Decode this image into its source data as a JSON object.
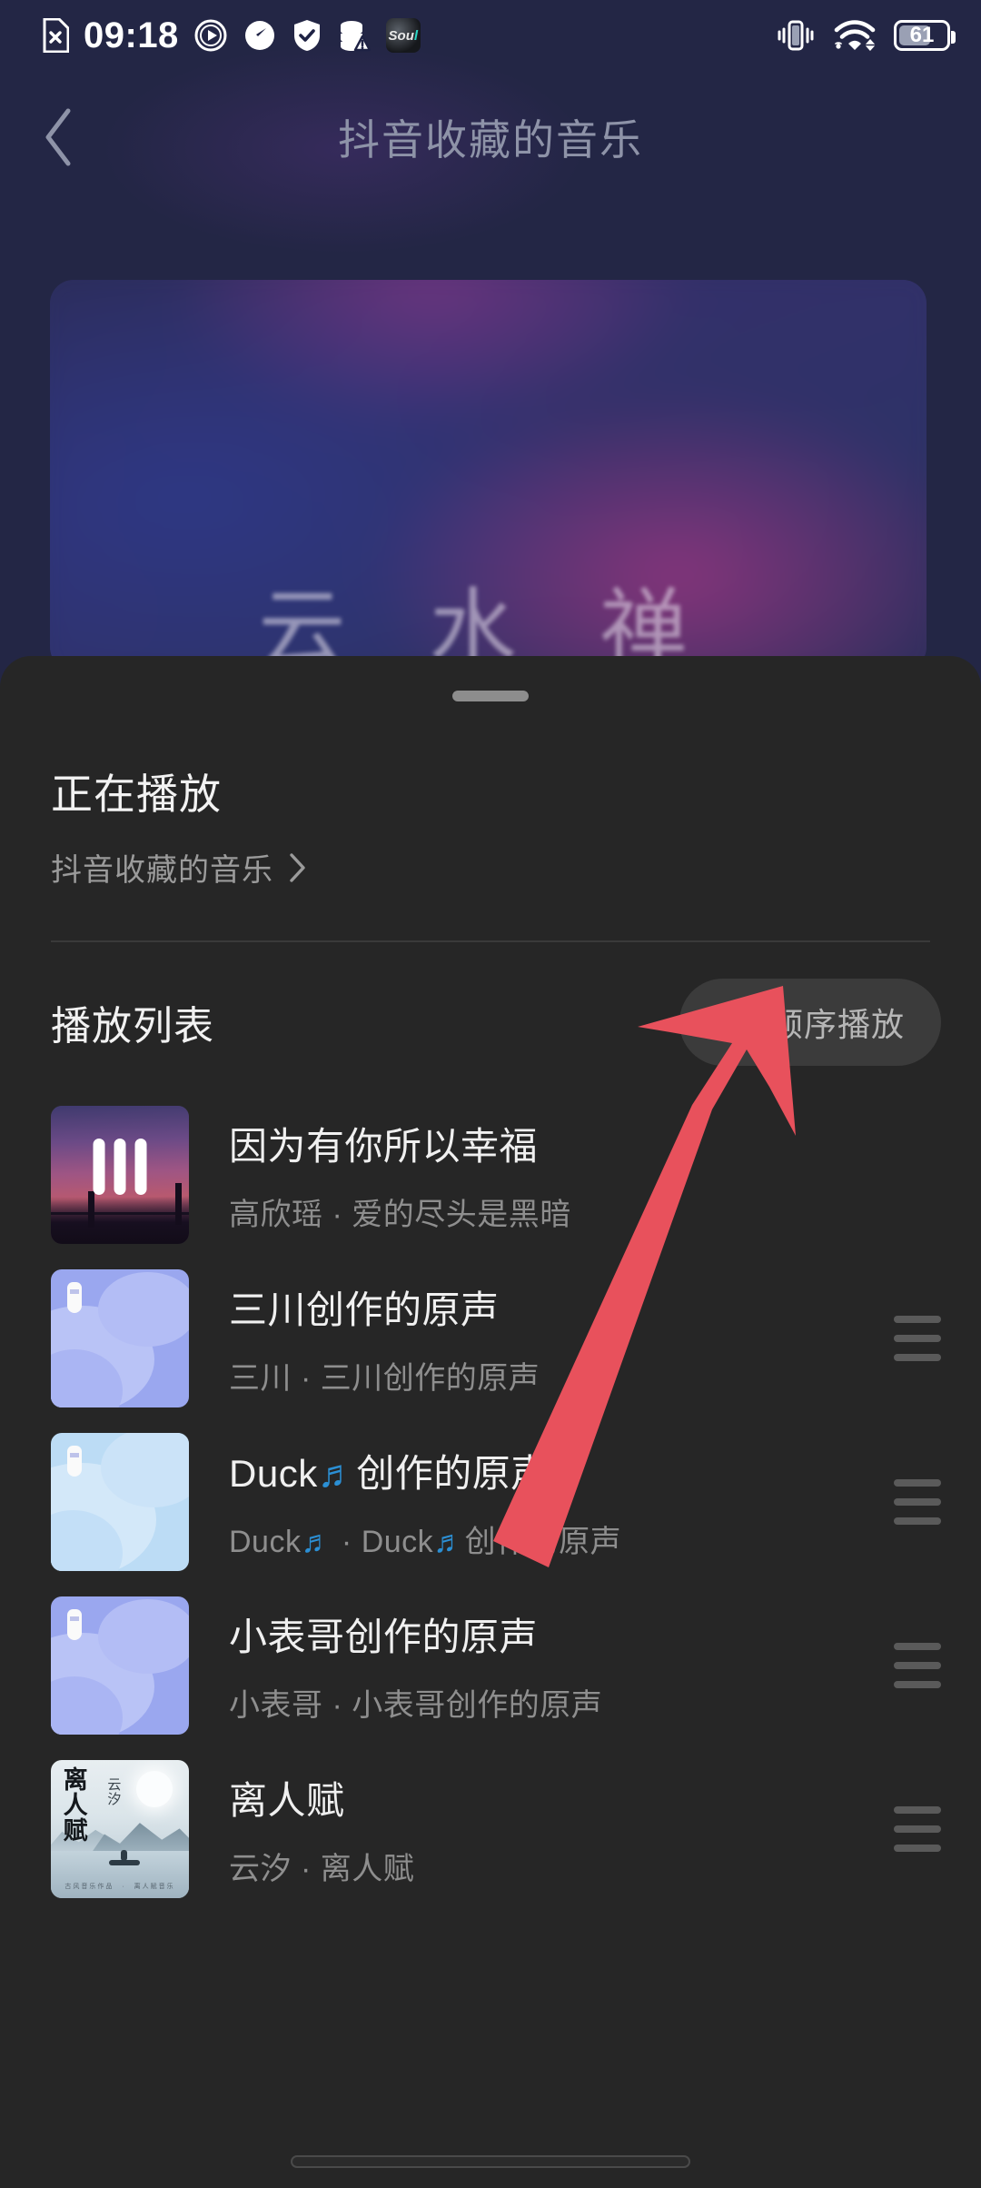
{
  "status_bar": {
    "time": "09:18",
    "battery_percent": "61",
    "left_icons": [
      "sim-error-icon",
      "play-circle-icon",
      "speedometer-icon",
      "shield-check-icon",
      "database-warning-icon",
      "soul-app-icon"
    ],
    "right_icons": [
      "vibrate-icon",
      "wifi-icon",
      "battery-icon"
    ],
    "soul_label": "Sou",
    "soul_label_accent": "l"
  },
  "header": {
    "back_icon": "chevron-left-icon",
    "title": "抖音收藏的音乐"
  },
  "artwork": {
    "script_text": "云 水 禅",
    "alt": "blurred purple magenta night sky album art"
  },
  "sheet": {
    "grabber": "sheet-drag-handle",
    "now_playing_label": "正在播放",
    "source_label": "抖音收藏的音乐",
    "source_chevron": "chevron-right-icon",
    "playlist_label": "播放列表",
    "play_mode": {
      "icon": "repeat-icon",
      "label": "顺序播放"
    }
  },
  "tracks": [
    {
      "name": "因为有你所以幸福",
      "artist": "高欣瑶 · 爱的尽头是黑暗",
      "cover": "sunset-bridge",
      "playing": true,
      "drag_handle": false
    },
    {
      "name": "三川创作的原声",
      "artist": "三川 · 三川创作的原声",
      "cover": "blob-periwinkle",
      "playing": false,
      "drag_handle": true
    },
    {
      "name_prefix": "Duck",
      "name_note": "♬",
      "name_suffix": "创作的原声",
      "name": "Duck♬创作的原声",
      "artist": "Duck♬ · Duck♬创作的原声",
      "cover": "blob-lightblue",
      "playing": false,
      "drag_handle": true
    },
    {
      "name": "小表哥创作的原声",
      "artist": "小表哥 · 小表哥创作的原声",
      "cover": "blob-periwinkle",
      "playing": false,
      "drag_handle": true
    },
    {
      "name": "离人赋",
      "artist": "云汐 · 离人赋",
      "cover": "ink-landscape",
      "cover_title": "离\n人\n赋",
      "cover_subtitle": "云\n汐",
      "cover_footer": "古风音乐作品　·　离人赋音乐",
      "playing": false,
      "drag_handle": true
    }
  ],
  "annotation": {
    "type": "arrow",
    "color": "#e8515c",
    "points_to": "play-mode-button"
  },
  "colors": {
    "sheet_bg": "#262626",
    "page_bg": "#232645",
    "accent_note": "#2b8fd4",
    "arrow": "#e8515c",
    "mode_chip": "#3b3b3b"
  },
  "home_indicator": "home-indicator"
}
